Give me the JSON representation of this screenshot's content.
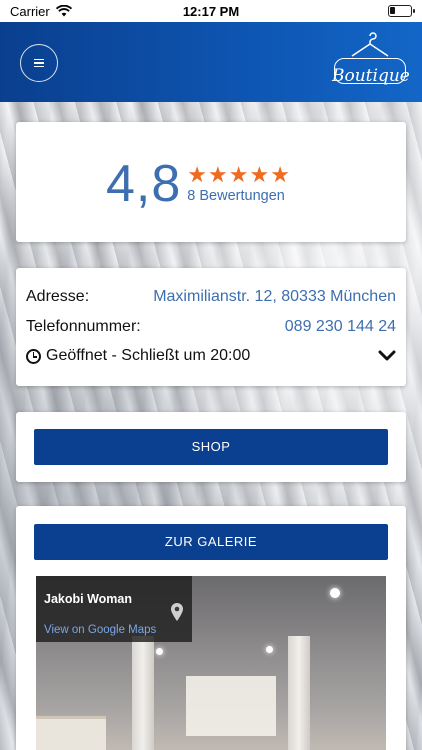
{
  "status_bar": {
    "carrier": "Carrier",
    "time": "12:17 PM",
    "battery_level": 0.25
  },
  "header": {
    "logo_text": "Boutique",
    "menu_icon": "hamburger-menu-icon"
  },
  "rating": {
    "value": "4,8",
    "stars": 5,
    "reviews": "8 Bewertungen",
    "star_color": "#ee6b1f"
  },
  "info": {
    "address_label": "Adresse:",
    "address_value": "Maximilianstr. 12, 80333 München",
    "phone_label": "Telefonnummer:",
    "phone_value": "089 230 144 24",
    "hours_text": "Geöffnet - Schließt um 20:00"
  },
  "buttons": {
    "shop": "SHOP",
    "gallery": "ZUR GALERIE"
  },
  "map": {
    "store_name": "Jakobi Woman",
    "link_text": "View on Google Maps"
  },
  "colors": {
    "brand_blue": "#0b3f8f",
    "link_blue": "#3d6fb0"
  }
}
